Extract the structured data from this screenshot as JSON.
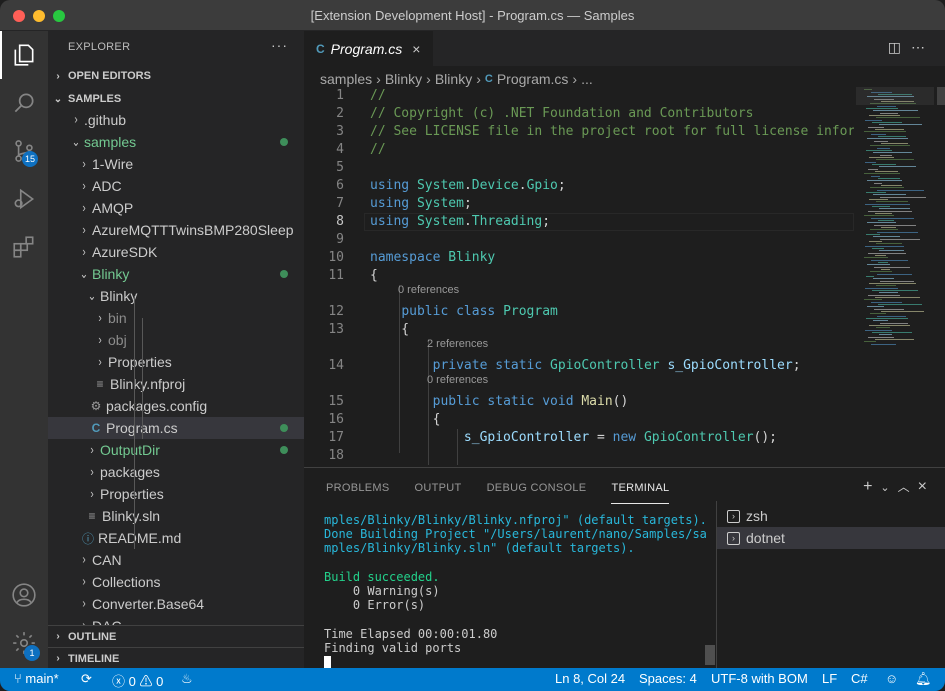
{
  "window": {
    "title": "[Extension Development Host] - Program.cs — Samples",
    "traffic_lights": [
      "#ff5f57",
      "#febc2e",
      "#28c840"
    ]
  },
  "activity_bar": {
    "items": [
      "explorer-icon",
      "search-icon",
      "source-control-icon",
      "run-debug-icon",
      "extensions-icon"
    ],
    "source_control_badge": "15",
    "bottom": [
      "account-icon",
      "manage-gear-icon"
    ],
    "manage_badge": "1"
  },
  "explorer": {
    "title": "EXPLORER",
    "more": "···",
    "open_editors": "OPEN EDITORS",
    "workspace": "SAMPLES",
    "outline": "OUTLINE",
    "timeline": "TIMELINE",
    "tree": [
      {
        "label": ".github",
        "chev": "›",
        "icon": "",
        "green": false,
        "dot": false
      },
      {
        "label": "samples",
        "chev": "⌄",
        "icon": "",
        "green": true,
        "dot": true
      },
      {
        "label": "1-Wire",
        "chev": "›",
        "icon": "",
        "green": false,
        "dot": false
      },
      {
        "label": "ADC",
        "chev": "›",
        "icon": "",
        "green": false,
        "dot": false
      },
      {
        "label": "AMQP",
        "chev": "›",
        "icon": "",
        "green": false,
        "dot": false
      },
      {
        "label": "AzureMQTTTwinsBMP280Sleep",
        "chev": "›",
        "icon": "",
        "green": false,
        "dot": false
      },
      {
        "label": "AzureSDK",
        "chev": "›",
        "icon": "",
        "green": false,
        "dot": false
      },
      {
        "label": "Blinky",
        "chev": "⌄",
        "icon": "",
        "green": true,
        "dot": true
      },
      {
        "label": "Blinky",
        "chev": "⌄",
        "icon": "",
        "green": false,
        "dot": false
      },
      {
        "label": "bin",
        "chev": "›",
        "icon": "",
        "green": false,
        "dot": false,
        "dim": true
      },
      {
        "label": "obj",
        "chev": "›",
        "icon": "",
        "green": false,
        "dot": false,
        "dim": true
      },
      {
        "label": "Properties",
        "chev": "›",
        "icon": "",
        "green": false,
        "dot": false
      },
      {
        "label": "Blinky.nfproj",
        "chev": "",
        "icon": "≡",
        "green": false,
        "dot": false
      },
      {
        "label": "packages.config",
        "chev": "",
        "icon": "⚙",
        "green": false,
        "dot": false
      },
      {
        "label": "Program.cs",
        "chev": "",
        "icon": "C",
        "green": false,
        "dot": true,
        "selected": true
      },
      {
        "label": "OutputDir",
        "chev": "›",
        "icon": "",
        "green": true,
        "dot": true
      },
      {
        "label": "packages",
        "chev": "›",
        "icon": "",
        "green": false,
        "dot": false
      },
      {
        "label": "Properties",
        "chev": "›",
        "icon": "",
        "green": false,
        "dot": false
      },
      {
        "label": "Blinky.sln",
        "chev": "",
        "icon": "≡",
        "green": false,
        "dot": false
      },
      {
        "label": "README.md",
        "chev": "",
        "icon": "ⓘ",
        "green": false,
        "dot": false
      },
      {
        "label": "CAN",
        "chev": "›",
        "icon": "",
        "green": false,
        "dot": false
      },
      {
        "label": "Collections",
        "chev": "›",
        "icon": "",
        "green": false,
        "dot": false
      },
      {
        "label": "Converter.Base64",
        "chev": "›",
        "icon": "",
        "green": false,
        "dot": false
      },
      {
        "label": "DAC",
        "chev": "›",
        "icon": "",
        "green": false,
        "dot": false
      }
    ]
  },
  "editor": {
    "tab_label": "Program.cs",
    "tab_lang_icon": "C",
    "close": "×",
    "breadcrumbs": [
      "samples",
      "Blinky",
      "Blinky",
      "Program.cs",
      "..."
    ],
    "breadcrumb_sep": "›",
    "lines": [
      {
        "n": "1",
        "t": "//"
      },
      {
        "n": "2",
        "t": "// Copyright (c) .NET Foundation and Contributors"
      },
      {
        "n": "3",
        "t": "// See LICENSE file in the project root for full license information."
      },
      {
        "n": "4",
        "t": "//"
      },
      {
        "n": "5",
        "t": ""
      },
      {
        "n": "6",
        "t": "using System.Device.Gpio;"
      },
      {
        "n": "7",
        "t": "using System;"
      },
      {
        "n": "8",
        "t": "using System.Threading;"
      },
      {
        "n": "9",
        "t": ""
      },
      {
        "n": "10",
        "t": "namespace Blinky"
      },
      {
        "n": "11",
        "t": "{"
      },
      {
        "n": "12",
        "t": "    public class Program"
      },
      {
        "n": "13",
        "t": "    {"
      },
      {
        "n": "14",
        "t": "        private static GpioController s_GpioController;"
      },
      {
        "n": "15",
        "t": "        public static void Main()"
      },
      {
        "n": "16",
        "t": "        {"
      },
      {
        "n": "17",
        "t": "            s_GpioController = new GpioController();"
      },
      {
        "n": "18",
        "t": ""
      }
    ],
    "code_lens": [
      "0 references",
      "2 references",
      "0 references"
    ],
    "current_line": "8"
  },
  "panel": {
    "tabs": [
      "PROBLEMS",
      "OUTPUT",
      "DEBUG CONSOLE",
      "TERMINAL"
    ],
    "active_tab": "TERMINAL",
    "terminal_lines": [
      "mples/Blinky/Blinky/Blinky.nfproj\" (default targets).",
      "Done Building Project \"/Users/laurent/nano/Samples/sa",
      "mples/Blinky/Blinky.sln\" (default targets).",
      "",
      "Build succeeded.",
      "    0 Warning(s)",
      "    0 Error(s)",
      "",
      "Time Elapsed 00:00:01.80",
      "Finding valid ports"
    ],
    "terminals": [
      "zsh",
      "dotnet"
    ],
    "active_terminal": "dotnet"
  },
  "status_bar": {
    "branch": "main*",
    "errors": "0",
    "warnings": "0",
    "position": "Ln 8, Col 24",
    "spaces": "Spaces: 4",
    "encoding": "UTF-8 with BOM",
    "eol": "LF",
    "language": "C#"
  }
}
